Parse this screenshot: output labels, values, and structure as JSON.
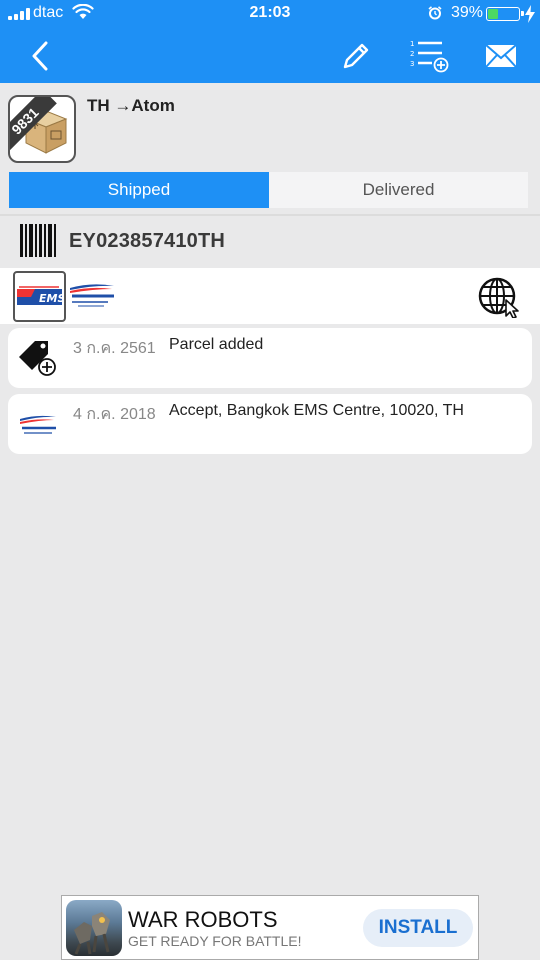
{
  "status_bar": {
    "carrier": "dtac",
    "time": "21:03",
    "battery_pct": "39%",
    "battery_level": 0.39,
    "icons": [
      "signal-icon",
      "wifi-icon",
      "alarm-icon",
      "battery-icon",
      "charging-icon"
    ]
  },
  "nav": {
    "back_icon": "chevron-left-icon",
    "edit_icon": "pencil-icon",
    "list_add_icon": "numbered-list-add-icon",
    "mail_icon": "envelope-icon"
  },
  "header": {
    "badge_text": "9831",
    "title": "TH →Atom"
  },
  "tabs": [
    {
      "label": "Shipped",
      "active": true
    },
    {
      "label": "Delivered",
      "active": false
    }
  ],
  "parcel": {
    "tracking_number": "EY023857410TH"
  },
  "events": [
    {
      "date": "3 ก.ค. 2561",
      "text": "Parcel added",
      "icon": "tag-add-icon"
    },
    {
      "date": "4 ก.ค. 2018",
      "text": "Accept, Bangkok EMS Centre, 10020, TH",
      "icon": "thailand-post-logo-icon"
    }
  ],
  "ad": {
    "title": "WAR ROBOTS",
    "subtitle": "GET READY FOR BATTLE!",
    "button": "INSTALL"
  },
  "colors": {
    "accent": "#1e90f5",
    "background": "#e9e9ea",
    "ad_button_text": "#1a6fd0"
  }
}
